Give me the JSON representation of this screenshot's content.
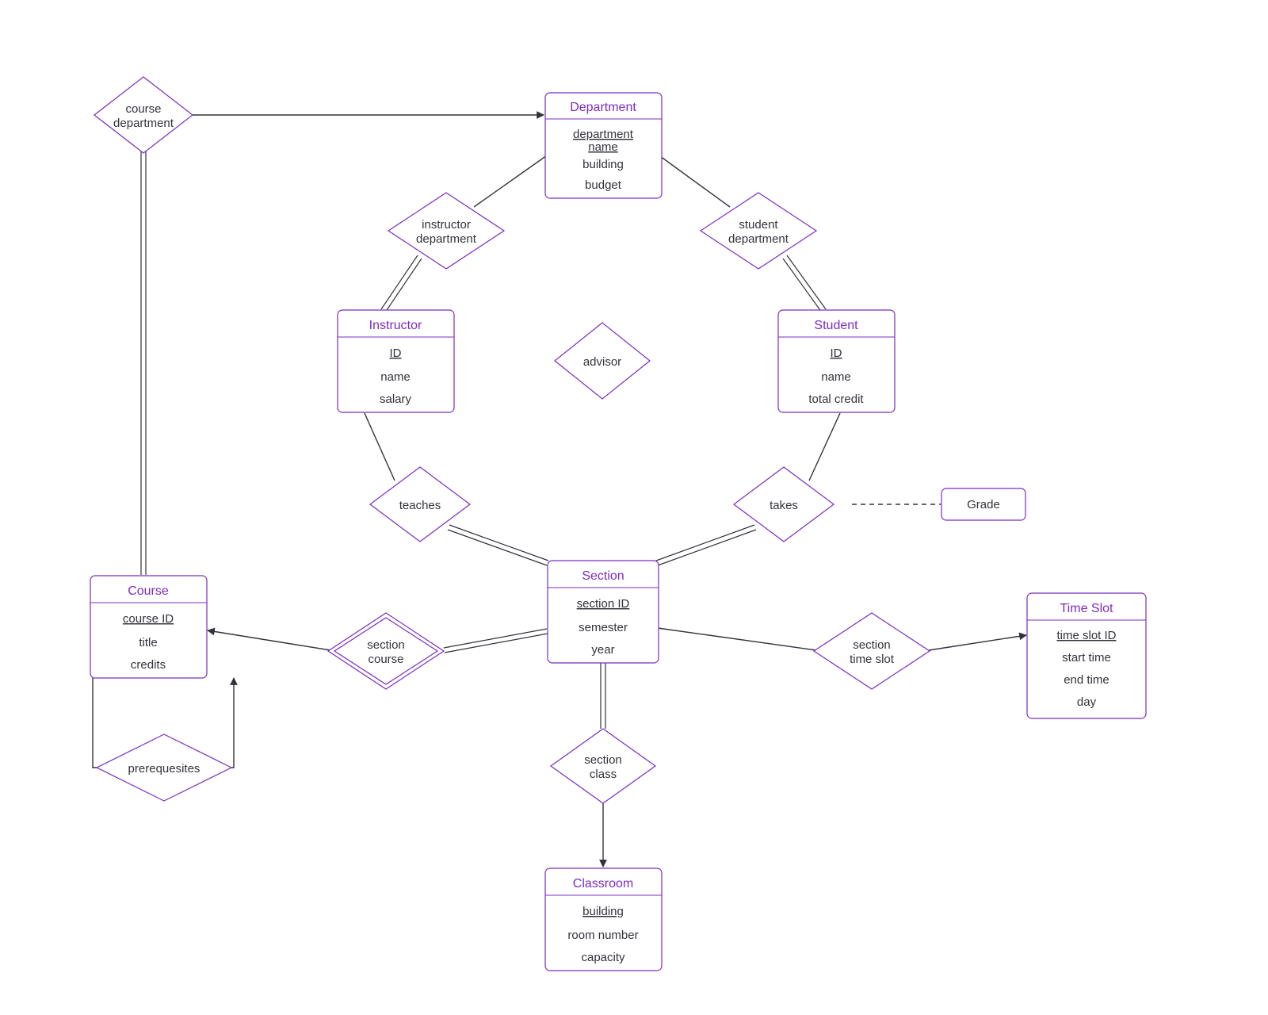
{
  "entities": {
    "department": {
      "title": "Department",
      "key": "department name",
      "attrs": [
        "building",
        "budget"
      ]
    },
    "instructor": {
      "title": "Instructor",
      "key": "ID",
      "attrs": [
        "name",
        "salary"
      ]
    },
    "student": {
      "title": "Student",
      "key": "ID",
      "attrs": [
        "name",
        "total credit"
      ]
    },
    "section": {
      "title": "Section",
      "key": "section ID",
      "attrs": [
        "semester",
        "year"
      ]
    },
    "course": {
      "title": "Course",
      "key": "course ID",
      "attrs": [
        "title",
        "credits"
      ]
    },
    "classroom": {
      "title": "Classroom",
      "key": "building",
      "attrs": [
        "room number",
        "capacity"
      ]
    },
    "timeslot": {
      "title": "Time Slot",
      "key": "time slot ID",
      "attrs": [
        "start time",
        "end time",
        "day"
      ]
    },
    "grade": {
      "title": "Grade"
    }
  },
  "relationships": {
    "course_department": {
      "l1": "course",
      "l2": "department"
    },
    "instructor_department": {
      "l1": "instructor",
      "l2": "department"
    },
    "student_department": {
      "l1": "student",
      "l2": "department"
    },
    "advisor": {
      "l1": "advisor"
    },
    "teaches": {
      "l1": "teaches"
    },
    "takes": {
      "l1": "takes"
    },
    "section_course": {
      "l1": "section",
      "l2": "course"
    },
    "section_timeslot": {
      "l1": "section",
      "l2": "time slot"
    },
    "section_class": {
      "l1": "section",
      "l2": "class"
    },
    "prerequisites": {
      "l1": "prerequesites"
    }
  }
}
